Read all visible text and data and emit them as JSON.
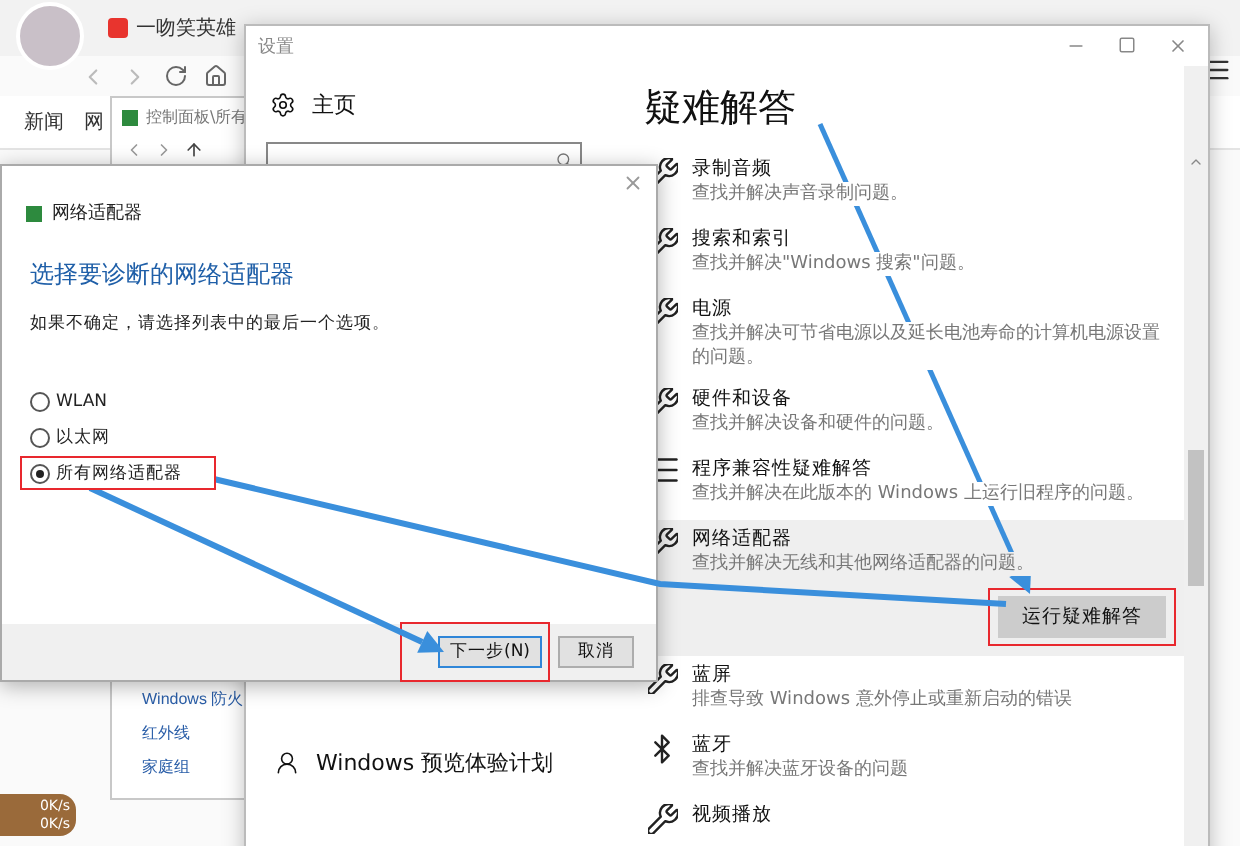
{
  "browser": {
    "tabs": [
      {
        "label": "一吻笑英雄"
      }
    ],
    "nav_links": [
      "新闻",
      "网"
    ]
  },
  "control_panel": {
    "title": "控制面板\\所有",
    "links": [
      "Windows 防火",
      "红外线",
      "家庭组"
    ]
  },
  "speed_widget": {
    "readings": [
      "0K/s",
      "0K/s"
    ]
  },
  "settings": {
    "title": "设置",
    "home": "主页",
    "footer_item": "Windows 预览体验计划",
    "heading": "疑难解答",
    "run_button": "运行疑难解答",
    "items": [
      {
        "kind": "wrench",
        "name": "录制音频",
        "description": "查找并解决声音录制问题。",
        "selected": false
      },
      {
        "kind": "wrench",
        "name": "搜索和索引",
        "description": "查找并解决\"Windows 搜索\"问题。",
        "selected": false
      },
      {
        "kind": "wrench",
        "name": "电源",
        "description": "查找并解决可节省电源以及延长电池寿命的计算机电源设置的问题。",
        "selected": false
      },
      {
        "kind": "wrench",
        "name": "硬件和设备",
        "description": "查找并解决设备和硬件的问题。",
        "selected": false
      },
      {
        "kind": "list",
        "name": "程序兼容性疑难解答",
        "description": "查找并解决在此版本的 Windows 上运行旧程序的问题。",
        "selected": false
      },
      {
        "kind": "wrench",
        "name": "网络适配器",
        "description": "查找并解决无线和其他网络适配器的问题。",
        "selected": true
      },
      {
        "kind": "wrench",
        "name": "蓝屏",
        "description": "排查导致 Windows 意外停止或重新启动的错误",
        "selected": false
      },
      {
        "kind": "bluetooth",
        "name": "蓝牙",
        "description": "查找并解决蓝牙设备的问题",
        "selected": false
      },
      {
        "kind": "wrench",
        "name": "视频播放",
        "selected": false
      }
    ]
  },
  "dialog": {
    "title": "网络适配器",
    "heading": "选择要诊断的网络适配器",
    "hint": "如果不确定，请选择列表中的最后一个选项。",
    "options": [
      {
        "label": "WLAN",
        "selected": false
      },
      {
        "label": "以太网",
        "selected": false
      },
      {
        "label": "所有网络适配器",
        "selected": true
      }
    ],
    "buttons": [
      {
        "label": "下一步(N)",
        "kind": "primary"
      },
      {
        "label": "取消",
        "kind": "secondary"
      }
    ]
  }
}
